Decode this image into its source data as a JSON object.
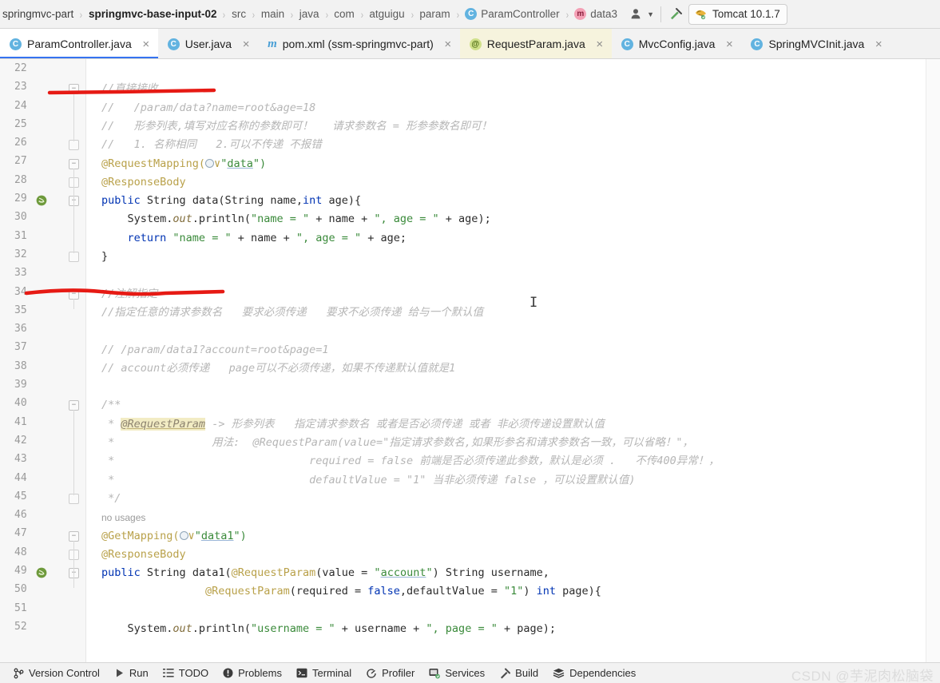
{
  "breadcrumb": {
    "items": [
      {
        "label": "springmvc-part",
        "kind": "module",
        "bold": false
      },
      {
        "label": "springmvc-base-input-02",
        "kind": "module",
        "bold": true
      },
      {
        "label": "src",
        "kind": "folder",
        "bold": false
      },
      {
        "label": "main",
        "kind": "folder",
        "bold": false
      },
      {
        "label": "java",
        "kind": "folder",
        "bold": false
      },
      {
        "label": "com",
        "kind": "package",
        "bold": false
      },
      {
        "label": "atguigu",
        "kind": "package",
        "bold": false
      },
      {
        "label": "param",
        "kind": "package",
        "bold": false
      },
      {
        "label": "ParamController",
        "kind": "class",
        "badge": "C",
        "bold": false
      },
      {
        "label": "data3",
        "kind": "method",
        "badge": "m",
        "bold": false
      }
    ],
    "separator": "›",
    "profile_icon": "user-profile-icon",
    "dropdown_icon": "chevron-down-icon",
    "build_icon": "hammer-icon",
    "run_config": {
      "label": "Tomcat 10.1.7",
      "icon": "tomcat-icon"
    }
  },
  "tabs": [
    {
      "label": "ParamController.java",
      "icon": "java-class-icon",
      "state": "active",
      "close": "×"
    },
    {
      "label": "User.java",
      "icon": "java-class-icon",
      "state": "normal",
      "close": "×"
    },
    {
      "label": "pom.xml (ssm-springmvc-part)",
      "icon": "maven-icon",
      "state": "normal",
      "close": "×"
    },
    {
      "label": "RequestParam.java",
      "icon": "annotation-icon",
      "state": "highlight",
      "close": "×"
    },
    {
      "label": "MvcConfig.java",
      "icon": "java-class-icon",
      "state": "normal",
      "close": "×"
    },
    {
      "label": "SpringMVCInit.java",
      "icon": "java-class-icon",
      "state": "normal",
      "close": "×"
    }
  ],
  "editor": {
    "first_line_number": 22,
    "line_numbers": [
      22,
      23,
      24,
      25,
      26,
      27,
      28,
      29,
      30,
      31,
      32,
      33,
      34,
      35,
      36,
      37,
      38,
      39,
      40,
      41,
      42,
      43,
      44,
      45,
      46,
      47,
      48,
      49,
      50,
      51,
      52
    ],
    "gutter_marks": [
      {
        "line": 29,
        "icon": "spring-bean-icon"
      },
      {
        "line": 49,
        "icon": "spring-bean-icon"
      }
    ],
    "code": [
      {
        "line": 22,
        "segments": []
      },
      {
        "line": 23,
        "segments": [
          {
            "t": "//直接接收",
            "c": "cmt"
          }
        ]
      },
      {
        "line": 24,
        "segments": [
          {
            "t": "//   /param/data?name=root&age=18",
            "c": "cmt"
          }
        ]
      },
      {
        "line": 25,
        "segments": [
          {
            "t": "//   形参列表,填写对应名称的参数即可！   请求参数名 = 形参参数名即可！",
            "c": "cmt"
          }
        ]
      },
      {
        "line": 26,
        "segments": [
          {
            "t": "//   1. 名称相同   2.可以不传递 不报错",
            "c": "cmt"
          }
        ]
      },
      {
        "line": 27,
        "segments": [
          {
            "t": "@RequestMapping(",
            "c": "anno"
          },
          {
            "t": "GLOBE",
            "c": "globe"
          },
          {
            "t": "∨",
            "c": "anno"
          },
          {
            "t": "\"",
            "c": "str"
          },
          {
            "t": "data",
            "c": "str ul"
          },
          {
            "t": "\")",
            "c": "str"
          }
        ]
      },
      {
        "line": 28,
        "segments": [
          {
            "t": "@ResponseBody",
            "c": "anno"
          }
        ]
      },
      {
        "line": 29,
        "segments": [
          {
            "t": "public ",
            "c": "kw"
          },
          {
            "t": "String ",
            "c": "plain"
          },
          {
            "t": "data(",
            "c": "plain"
          },
          {
            "t": "String ",
            "c": "plain"
          },
          {
            "t": "name,",
            "c": "plain"
          },
          {
            "t": "int ",
            "c": "kw"
          },
          {
            "t": "age){",
            "c": "plain"
          }
        ]
      },
      {
        "line": 30,
        "segments": [
          {
            "t": "    System.",
            "c": "plain"
          },
          {
            "t": "out",
            "c": "stat"
          },
          {
            "t": ".println(",
            "c": "plain"
          },
          {
            "t": "\"name = \"",
            "c": "str"
          },
          {
            "t": " + name + ",
            "c": "plain"
          },
          {
            "t": "\", age = \"",
            "c": "str"
          },
          {
            "t": " + age);",
            "c": "plain"
          }
        ]
      },
      {
        "line": 31,
        "segments": [
          {
            "t": "    ",
            "c": "plain"
          },
          {
            "t": "return ",
            "c": "kw"
          },
          {
            "t": "\"name = \"",
            "c": "str"
          },
          {
            "t": " + name + ",
            "c": "plain"
          },
          {
            "t": "\", age = \"",
            "c": "str"
          },
          {
            "t": " + age;",
            "c": "plain"
          }
        ]
      },
      {
        "line": 32,
        "segments": [
          {
            "t": "}",
            "c": "plain"
          }
        ]
      },
      {
        "line": 33,
        "segments": []
      },
      {
        "line": 34,
        "segments": [
          {
            "t": "//注解指定",
            "c": "cmt"
          }
        ]
      },
      {
        "line": 35,
        "segments": [
          {
            "t": "//指定任意的请求参数名   要求必须传递   要求不必须传递 给与一个默认值",
            "c": "cmt"
          }
        ]
      },
      {
        "line": 36,
        "segments": []
      },
      {
        "line": 37,
        "segments": [
          {
            "t": "// /param/data1?account=root&page=1",
            "c": "cmt"
          }
        ]
      },
      {
        "line": 38,
        "segments": [
          {
            "t": "// account必须传递   page可以不必须传递，如果不传递默认值就是1",
            "c": "cmt"
          }
        ]
      },
      {
        "line": 39,
        "segments": []
      },
      {
        "line": 40,
        "segments": [
          {
            "t": "/**",
            "c": "cmt"
          }
        ]
      },
      {
        "line": 41,
        "segments": [
          {
            "t": " * ",
            "c": "cmt"
          },
          {
            "t": "@RequestParam",
            "c": "hl"
          },
          {
            "t": " -> 形参列表   指定请求参数名 或者是否必须传递 或者 非必须传递设置默认值",
            "c": "cmt"
          }
        ]
      },
      {
        "line": 42,
        "segments": [
          {
            "t": " *               用法:  @RequestParam(value=\"指定请求参数名,如果形参名和请求参数名一致，可以省略！\"，",
            "c": "cmt"
          }
        ]
      },
      {
        "line": 43,
        "segments": [
          {
            "t": " *                              required = false 前端是否必须传递此参数，默认是必须 .   不传400异常！，",
            "c": "cmt"
          }
        ]
      },
      {
        "line": 44,
        "segments": [
          {
            "t": " *                              defaultValue = \"1\" 当非必须传递 false ，可以设置默认值)",
            "c": "cmt"
          }
        ]
      },
      {
        "line": 45,
        "segments": [
          {
            "t": " */",
            "c": "cmt"
          }
        ]
      },
      {
        "line": 46,
        "segments": []
      },
      {
        "line": 47,
        "segments": [
          {
            "t": "@GetMapping(",
            "c": "anno"
          },
          {
            "t": "GLOBE",
            "c": "globe"
          },
          {
            "t": "∨",
            "c": "anno"
          },
          {
            "t": "\"",
            "c": "str"
          },
          {
            "t": "data1",
            "c": "str ul"
          },
          {
            "t": "\")",
            "c": "str"
          }
        ]
      },
      {
        "line": 48,
        "segments": [
          {
            "t": "@ResponseBody",
            "c": "anno"
          }
        ]
      },
      {
        "line": 49,
        "segments": [
          {
            "t": "public ",
            "c": "kw"
          },
          {
            "t": "String ",
            "c": "plain"
          },
          {
            "t": "data1(",
            "c": "plain"
          },
          {
            "t": "@RequestParam",
            "c": "anno"
          },
          {
            "t": "(value = ",
            "c": "plain"
          },
          {
            "t": "\"",
            "c": "str"
          },
          {
            "t": "account",
            "c": "str ul"
          },
          {
            "t": "\"",
            "c": "str"
          },
          {
            "t": ") String username,",
            "c": "plain"
          }
        ]
      },
      {
        "line": 50,
        "segments": [
          {
            "t": "                ",
            "c": "plain"
          },
          {
            "t": "@RequestParam",
            "c": "anno"
          },
          {
            "t": "(required = ",
            "c": "plain"
          },
          {
            "t": "false",
            "c": "kw"
          },
          {
            "t": ",defaultValue = ",
            "c": "plain"
          },
          {
            "t": "\"1\"",
            "c": "str"
          },
          {
            "t": ") ",
            "c": "plain"
          },
          {
            "t": "int ",
            "c": "kw"
          },
          {
            "t": "page){",
            "c": "plain"
          }
        ]
      },
      {
        "line": 51,
        "segments": []
      },
      {
        "line": 52,
        "segments": [
          {
            "t": "    System.",
            "c": "plain"
          },
          {
            "t": "out",
            "c": "stat"
          },
          {
            "t": ".println(",
            "c": "plain"
          },
          {
            "t": "\"username = \"",
            "c": "str"
          },
          {
            "t": " + username + ",
            "c": "plain"
          },
          {
            "t": "\", page = \"",
            "c": "str"
          },
          {
            "t": " + page);",
            "c": "plain"
          }
        ]
      }
    ],
    "inlay_hints": [
      {
        "line": 46,
        "text": "no usages"
      }
    ],
    "annotations": [
      {
        "name": "red-underline-top",
        "note": "red hand-drawn underline beneath //直接接收"
      },
      {
        "name": "red-underline-bottom",
        "note": "red hand-drawn underline beneath //注解指定"
      }
    ],
    "caret_symbol": "I"
  },
  "statusbar": {
    "items": [
      {
        "label": "Version Control",
        "icon": "branch-icon"
      },
      {
        "label": "Run",
        "icon": "run-icon"
      },
      {
        "label": "TODO",
        "icon": "todo-icon"
      },
      {
        "label": "Problems",
        "icon": "problems-icon"
      },
      {
        "label": "Terminal",
        "icon": "terminal-icon"
      },
      {
        "label": "Profiler",
        "icon": "profiler-icon"
      },
      {
        "label": "Services",
        "icon": "services-icon"
      },
      {
        "label": "Build",
        "icon": "build-icon"
      },
      {
        "label": "Dependencies",
        "icon": "dependencies-icon"
      }
    ],
    "watermark": "CSDN @芋泥肉松脑袋"
  },
  "colors": {
    "accent_blue": "#3573f0",
    "annotation_red": "#e61a14",
    "comment_gray": "#b6b6b6",
    "keyword_blue": "#0033b3",
    "string_green": "#3a8a3a",
    "annotation_yellow": "#b9a14a",
    "tab_highlight": "#f6f3dd"
  }
}
